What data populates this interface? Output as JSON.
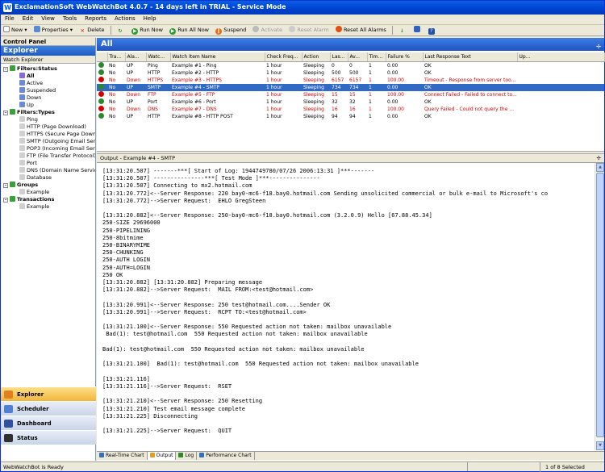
{
  "app": {
    "title": "ExclamationSoft WebWatchBot 4.0.7 - 14 days left in TRIAL - Service Mode"
  },
  "menu": [
    "File",
    "Edit",
    "View",
    "Tools",
    "Reports",
    "Actions",
    "Help"
  ],
  "toolbar": {
    "new": "New",
    "properties": "Properties",
    "delete": "Delete",
    "run_now": "Run Now",
    "run_all_now": "Run All Now",
    "suspend": "Suspend",
    "activate": "Activate",
    "reset_alarm": "Reset Alarm",
    "reset_all_alarms": "Reset All Alarms"
  },
  "left": {
    "control_panel": "Control Panel",
    "explorer_title": "Explorer",
    "watch_explorer": "Watch Explorer",
    "tree": [
      "Filters:Status",
      "All",
      "Active",
      "Suspended",
      "Down",
      "Up",
      "Filters:Types",
      "Ping",
      "HTTP (Page Download)",
      "HTTPS (Secure Page Download)",
      "SMTP (Outgoing Email Server)",
      "POP3 (Incoming Email Server)",
      "FTP (File Transfer Protocol)",
      "Port",
      "DNS (Domain Name Service)",
      "Database",
      "Groups",
      "Example",
      "Transactions",
      "Example"
    ],
    "nav": [
      "Explorer",
      "Scheduler",
      "Dashboard",
      "Status"
    ]
  },
  "grid": {
    "title": "All",
    "columns": [
      "Tra...",
      "Ala...",
      "Watc...",
      "Watch Item Name",
      "Check Freq...",
      "Action",
      "Las...",
      "Av...",
      "Tim...",
      "Failure %",
      "Last Response Text",
      "Up..."
    ],
    "rows": [
      [
        "No",
        "UP",
        "Ping",
        "Example #1 - Ping",
        "1 hour",
        "Sleeping",
        "0",
        "0",
        "1",
        "0.00",
        "OK",
        ""
      ],
      [
        "No",
        "UP",
        "HTTP",
        "Example #2 - HTTP",
        "1 hour",
        "Sleeping",
        "500",
        "500",
        "1",
        "0.00",
        "OK",
        ""
      ],
      [
        "No",
        "Down",
        "HTTPS",
        "Example #3 - HTTPS",
        "1 hour",
        "Sleeping",
        "6157",
        "6157",
        "1",
        "100.00",
        "Timeout - Response from server too...",
        ""
      ],
      [
        "No",
        "UP",
        "SMTP",
        "Example #4 - SMTP",
        "1 hour",
        "Sleeping",
        "734",
        "734",
        "1",
        "0.00",
        "OK",
        ""
      ],
      [
        "No",
        "Down",
        "FTP",
        "Example #5 - FTP",
        "1 hour",
        "Sleeping",
        "15",
        "15",
        "1",
        "100.00",
        "Connect Failed - Failed to connect to...",
        ""
      ],
      [
        "No",
        "UP",
        "Port",
        "Example #6 - Port",
        "1 hour",
        "Sleeping",
        "32",
        "32",
        "1",
        "0.00",
        "OK",
        ""
      ],
      [
        "No",
        "Down",
        "DNS",
        "Example #7 - DNS",
        "1 hour",
        "Sleeping",
        "16",
        "16",
        "1",
        "100.00",
        "Query Failed - Could not query the ...",
        ""
      ],
      [
        "No",
        "UP",
        "HTTP",
        "Example #8 - HTTP POST",
        "1 hour",
        "Sleeping",
        "94",
        "94",
        "1",
        "0.00",
        "OK",
        ""
      ]
    ]
  },
  "output": {
    "title": "Output - Example #4 - SMTP",
    "log": "[13:31:20.507] -------***[ Start of Log: 1944749780/07/26 2006:13:31 ]***-------\n[13:31:20.507] ---------------***[ Test Mode ]***---------------\n[13:31:20.507] Connecting to mx2.hotmail.com\n[13:31:20.772]<--Server Response: 220 bay0-mc6-f18.bay0.hotmail.com Sending unsolicited commercial or bulk e-mail to Microsoft's co\n[13:31:20.772]-->Server Request:  EHLO GregSteen\n\n[13:31:20.882]<--Server Response: 250-bay0-mc6-f18.bay0.hotmail.com (3.2.0.9) Hello [67.88.45.34]\n250-SIZE 29696000\n250-PIPELINING\n250-8bitmime\n250-BINARYMIME\n250-CHUNKING\n250-AUTH LOGIN\n250-AUTH=LOGIN\n250 OK\n[13:31:20.882] [13:31:20.882] Preparing message\n[13:31:20.882]-->Server Request:  MAIL FROM:<test@hotmail.com>\n\n[13:31:20.991]<--Server Response: 250 test@hotmail.com....Sender OK\n[13:31:20.991]-->Server Request:  RCPT TO:<test@hotmail.com>\n\n[13:31:21.100]<--Server Response: 550 Requested action not taken: mailbox unavailable\n Bad(1): test@hotmail.com  550 Requested action not taken: mailbox unavailable\n\nBad(1): test@hotmail.com  550 Requested action not taken: mailbox unavailable\n\n[13:31:21.100]  Bad(1): test@hotmail.com  550 Requested action not taken: mailbox unavailable\n\n[13:31:21.116]\n[13:31:21.116]-->Server Request:  RSET\n\n[13:31:21.210]<--Server Response: 250 Resetting\n[13:31:21.210] Test email message complete\n[13:31:21.225] Disconnecting\n\n[13:31:21.225]-->Server Request:  QUIT",
    "tabs": [
      "Real-Time Chart",
      "Output",
      "Log",
      "Performance Chart"
    ]
  },
  "status": {
    "left": "WebWatchBot is Ready",
    "right": "1 of 8 Selected"
  },
  "colors": {
    "up": "#2a8a2a",
    "down": "#d40000",
    "accent": "#316ac5",
    "nav_active": "#f6c24a"
  }
}
